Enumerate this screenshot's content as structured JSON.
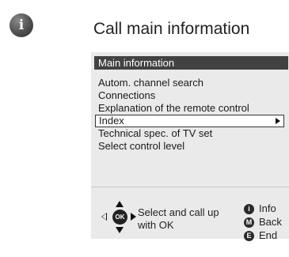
{
  "page": {
    "info_icon_glyph": "i",
    "heading": "Call main information"
  },
  "menu": {
    "title": "Main information",
    "items": [
      "Autom. channel search",
      "Connections",
      "Explanation of the remote control",
      "Index",
      "Technical spec. of TV set",
      "Select control level"
    ],
    "selected_index": 3
  },
  "footer": {
    "ok_key": "OK",
    "hint_line1": "Select and call up",
    "hint_line2": "with OK",
    "keys": [
      {
        "key": "i",
        "label": "Info"
      },
      {
        "key": "M",
        "label": "Back"
      },
      {
        "key": "E",
        "label": "End"
      }
    ]
  },
  "colors": {
    "title_bar": "#424242",
    "panel": "#eaeaea",
    "selected_row": "#ffffff"
  }
}
